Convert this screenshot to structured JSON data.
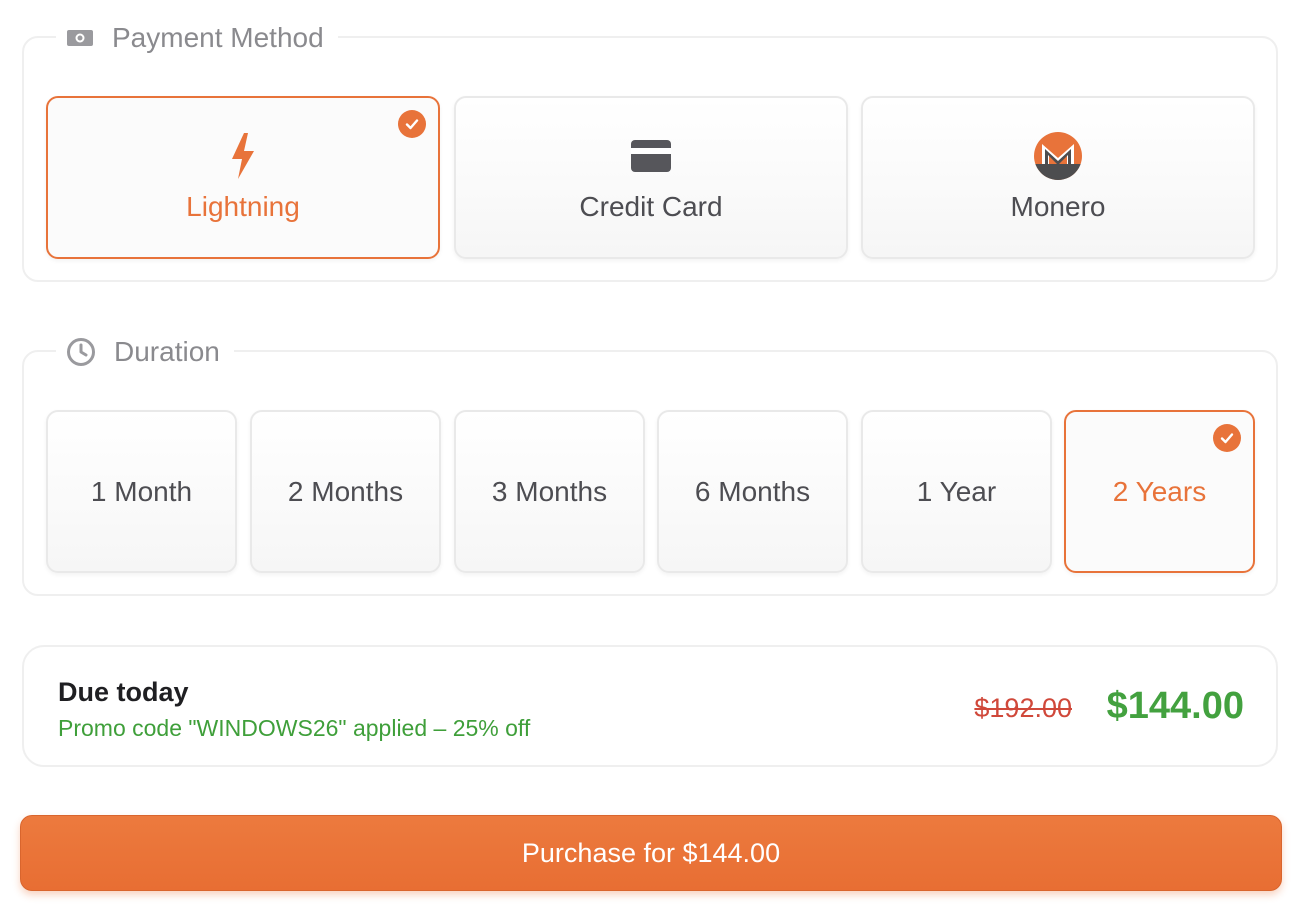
{
  "payment": {
    "legend": "Payment Method",
    "legend_icon": "money-bill-icon",
    "options": [
      {
        "label": "Lightning",
        "icon": "lightning-bolt-icon",
        "selected": true
      },
      {
        "label": "Credit Card",
        "icon": "credit-card-icon",
        "selected": false
      },
      {
        "label": "Monero",
        "icon": "monero-logo-icon",
        "selected": false
      }
    ]
  },
  "duration": {
    "legend": "Duration",
    "legend_icon": "clock-icon",
    "options": [
      {
        "label": "1 Month",
        "selected": false
      },
      {
        "label": "2 Months",
        "selected": false
      },
      {
        "label": "3 Months",
        "selected": false
      },
      {
        "label": "6 Months",
        "selected": false
      },
      {
        "label": "1 Year",
        "selected": false
      },
      {
        "label": "2 Years",
        "selected": true
      }
    ]
  },
  "summary": {
    "title": "Due today",
    "promo": "Promo code \"WINDOWS26\" applied – 25% off",
    "original_price": "$192.00",
    "final_price": "$144.00"
  },
  "purchase_button": {
    "label": "Purchase for $144.00"
  },
  "colors": {
    "accent": "#e8733a",
    "promo_green": "#3f9f3a",
    "price_green": "#43a13f",
    "strike_red": "#d0483a"
  }
}
